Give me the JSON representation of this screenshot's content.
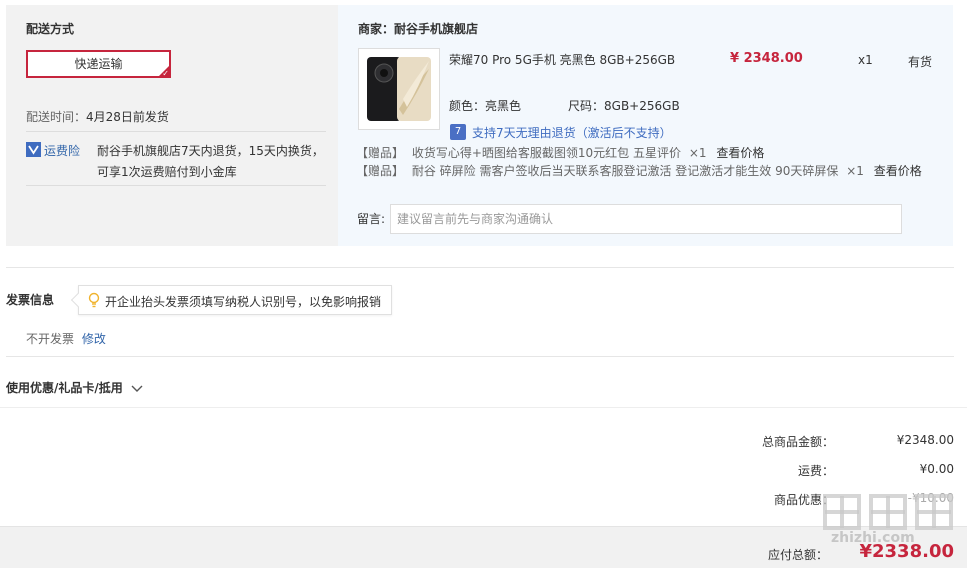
{
  "delivery": {
    "title": "配送方式",
    "method": "快递运输",
    "time_label": "配送时间：",
    "time_value": "4月28日前发货",
    "insurance_label": "运费险",
    "insurance_text_1": "耐谷手机旗舰店7天内退货，15天内换货，",
    "insurance_text_2": "可享1次运费赔付到小金库"
  },
  "merchant": {
    "title": "商家：耐谷手机旗舰店"
  },
  "product": {
    "name": "荣耀70 Pro 5G手机 亮黑色 8GB+256GB",
    "price": "¥ 2348.00",
    "qty": "x1",
    "stock": "有货",
    "color_label": "颜色：",
    "color_value": "亮黑色",
    "size_label": "尺码：",
    "size_value": "8GB+256GB",
    "return_policy": "支持7天无理由退货（激活后不支持）"
  },
  "gifts": [
    {
      "tag": "【赠品】",
      "text": "收货写心得+晒图给客服截图领10元红包 五星评价",
      "qty": "×1",
      "action": "查看价格"
    },
    {
      "tag": "【赠品】",
      "text": "耐谷 碎屏险 需客户签收后当天联系客服登记激活 登记激活才能生效 90天碎屏保",
      "qty": "×1",
      "action": "查看价格"
    }
  ],
  "remark": {
    "label": "留言:",
    "placeholder": "建议留言前先与商家沟通确认"
  },
  "invoice": {
    "title": "发票信息",
    "tip": "开企业抬头发票须填写纳税人识别号，以免影响报销",
    "status": "不开发票",
    "edit": "修改"
  },
  "coupon": {
    "title": "使用优惠/礼品卡/抵用"
  },
  "summary": {
    "rows": [
      {
        "label": "总商品金额：",
        "value": "¥2348.00"
      },
      {
        "label": "运费：",
        "value": "¥0.00"
      },
      {
        "label": "商品优惠：",
        "value": "-¥10.00"
      }
    ],
    "payable_label": "应付总额：",
    "payable_value": "¥2338.00"
  },
  "watermark": {
    "text": "值 值 值",
    "url": "zhizhi.com"
  },
  "colors": {
    "accent": "#c6253d",
    "link": "#3366aa",
    "icon_blue": "#3f6cc0"
  }
}
